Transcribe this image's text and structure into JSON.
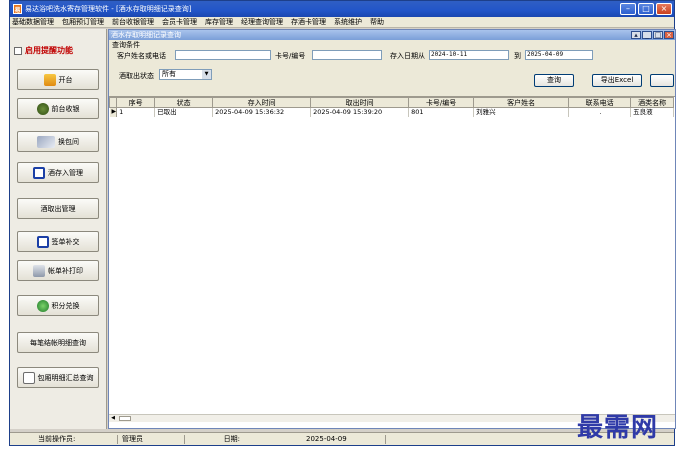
{
  "window": {
    "title": "易达浴吧洗水寄存管理软件 - [酒水存取明细记录查询]",
    "app_icon": "app-logo-icon"
  },
  "menu": [
    "基础数据管理",
    "包厢预订管理",
    "前台收银管理",
    "会员卡管理",
    "库存管理",
    "经理查询管理",
    "存酒卡管理",
    "系统维护",
    "帮助"
  ],
  "sidebar": {
    "remind_label": "启用提醒功能",
    "buttons": [
      {
        "label": "开台",
        "icon": "open-table-icon"
      },
      {
        "label": "前台收银",
        "icon": "cashier-bag-icon"
      },
      {
        "label": "换包间",
        "icon": "switch-room-icon"
      },
      {
        "label": "酒存入管理",
        "icon": "deposit-arrows-icon"
      },
      {
        "label": "酒取出管理",
        "icon": ""
      },
      {
        "label": "签单补交",
        "icon": "sign-bill-icon"
      },
      {
        "label": "帐单补打印",
        "icon": "printer-icon"
      },
      {
        "label": "积分兑换",
        "icon": "points-exchange-icon"
      },
      {
        "label": "每笔结帐明细查询",
        "icon": ""
      },
      {
        "label": "包厢明细汇总查询",
        "icon": "room-summary-icon"
      }
    ]
  },
  "child": {
    "title": "酒水存取明细记录查询"
  },
  "query": {
    "legend": "查询条件",
    "name_label": "客户姓名或电话",
    "name_value": "",
    "card_label": "卡号/编号",
    "card_value": "",
    "date_from_label": "存入日期从",
    "date_from": "2024-10-11",
    "date_to_label": "到",
    "date_to": "2025-04-09",
    "status_label": "酒取出状态",
    "status_value": "所有",
    "search_button": "查询",
    "export_button": "导出Excel"
  },
  "table": {
    "columns": [
      "序号",
      "状态",
      "存入时间",
      "取出时间",
      "卡号/编号",
      "客户姓名",
      "联系电话",
      "酒类名称"
    ],
    "rows": [
      [
        "1",
        "已取出",
        "2025-04-09 15:36:32",
        "2025-04-09 15:39:20",
        "801",
        "刘雅兴",
        ".",
        "五良液"
      ]
    ]
  },
  "status": {
    "operator_label": "当前操作员:",
    "operator": "管理员",
    "date_label": "日期:",
    "date": "2025-04-09"
  },
  "watermark": "最需网"
}
